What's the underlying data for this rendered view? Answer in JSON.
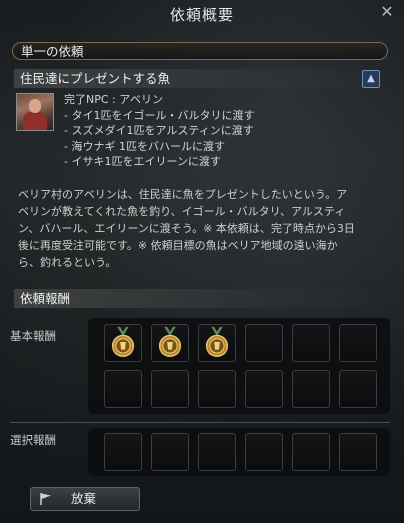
{
  "window": {
    "title": "依頼概要",
    "close_icon": "close-icon"
  },
  "category_bar": {
    "label": "単一の依頼"
  },
  "quest": {
    "title": "住民達にプレゼントする魚",
    "lines": [
      "完了NPC : アベリン",
      "- タイ1匹をイゴール・バルタリに渡す",
      "- スズメダイ1匹をアルスティンに渡す",
      "- 海ウナギ 1匹をバハールに渡す",
      "- イサキ1匹をエイリーンに渡す"
    ],
    "description_lines": [
      "ベリア村のアベリンは、住民達に魚をプレゼントしたいという。ア",
      "ベリンが教えてくれた魚を釣り、イゴール・バルタリ、アルスティ",
      "ン、バハール、エイリーンに渡そう。※ 本依頼は、完了時点から3日",
      "後に再度受注可能です。※ 依頼目標の魚はベリア地域の遠い海か",
      "ら、釣れるという。"
    ]
  },
  "rewards": {
    "header": "依頼報酬",
    "basic_label": "基本報酬",
    "choice_label": "選択報酬",
    "basic_slots": [
      {
        "item": "medal-icon"
      },
      {
        "item": "medal-icon"
      },
      {
        "item": "medal-icon"
      },
      {
        "item": ""
      },
      {
        "item": ""
      },
      {
        "item": ""
      },
      {
        "item": ""
      },
      {
        "item": ""
      },
      {
        "item": ""
      },
      {
        "item": ""
      },
      {
        "item": ""
      },
      {
        "item": ""
      }
    ],
    "choice_slots": [
      {
        "item": ""
      },
      {
        "item": ""
      },
      {
        "item": ""
      },
      {
        "item": ""
      },
      {
        "item": ""
      },
      {
        "item": ""
      }
    ]
  },
  "footer": {
    "abandon_label": "放棄"
  },
  "colors": {
    "accent_gold": "#c9a24a",
    "frame": "#7a6b4a"
  }
}
